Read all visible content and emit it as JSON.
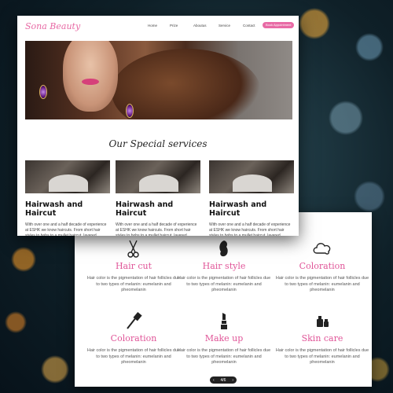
{
  "front": {
    "logo": "Sona Beauty",
    "menu": [
      {
        "label": "Home"
      },
      {
        "label": "Prize"
      },
      {
        "label": "Aboutus"
      },
      {
        "label": "Service"
      },
      {
        "label": "Contact"
      }
    ],
    "book_button": "Book Appointment",
    "section_title": "Our Special services",
    "promos": [
      {
        "title": "Hairwash and Haircut",
        "text": "With over one and a half decade of experience at ESHK we know haircuts. From short hair styles to bobs to a mullet haircut, layered hairstyles,"
      },
      {
        "title": "Hairwash and Haircut",
        "text": "With over one and a half decade of experience at ESHK we know haircuts. From short hair styles to bobs to a mullet haircut, layered hairstyles,"
      },
      {
        "title": "Hairwash and Haircut",
        "text": "With over one and a half decade of experience at ESHK we know haircuts. From short hair styles to bobs to a mullet haircut, layered hairstyles,"
      }
    ]
  },
  "back": {
    "services": [
      {
        "icon": "scissors-comb-icon",
        "title": "Hair cut",
        "text": "Hair color is the pigmentation of hair follicles due to two types of melanin: eumelanin and pheomelanin"
      },
      {
        "icon": "hair-style-icon",
        "title": "Hair style",
        "text": "Hair color is the pigmentation of hair follicles due to two types of melanin: eumelanin and pheomelanin"
      },
      {
        "icon": "cloud-color-icon",
        "title": "Coloration",
        "text": "Hair color is the pigmentation of hair follicles due to two types of melanin: eumelanin and pheomelanin"
      },
      {
        "icon": "dye-brush-icon",
        "title": "Coloration",
        "text": "Hair color is the pigmentation of hair follicles due to two types of melanin: eumelanin and pheomelanin"
      },
      {
        "icon": "lipstick-icon",
        "title": "Make up",
        "text": "Hair color is the pigmentation of hair follicles due to two types of melanin: eumelanin and pheomelanin"
      },
      {
        "icon": "skincare-bottles-icon",
        "title": "Skin care",
        "text": "Hair color is the pigmentation of hair follicles due to two types of melanin: eumelanin and pheomelanin"
      }
    ],
    "pager": {
      "prev": "‹",
      "label": "4/6",
      "next": "›"
    }
  },
  "colors": {
    "accent": "#e86aa5"
  }
}
